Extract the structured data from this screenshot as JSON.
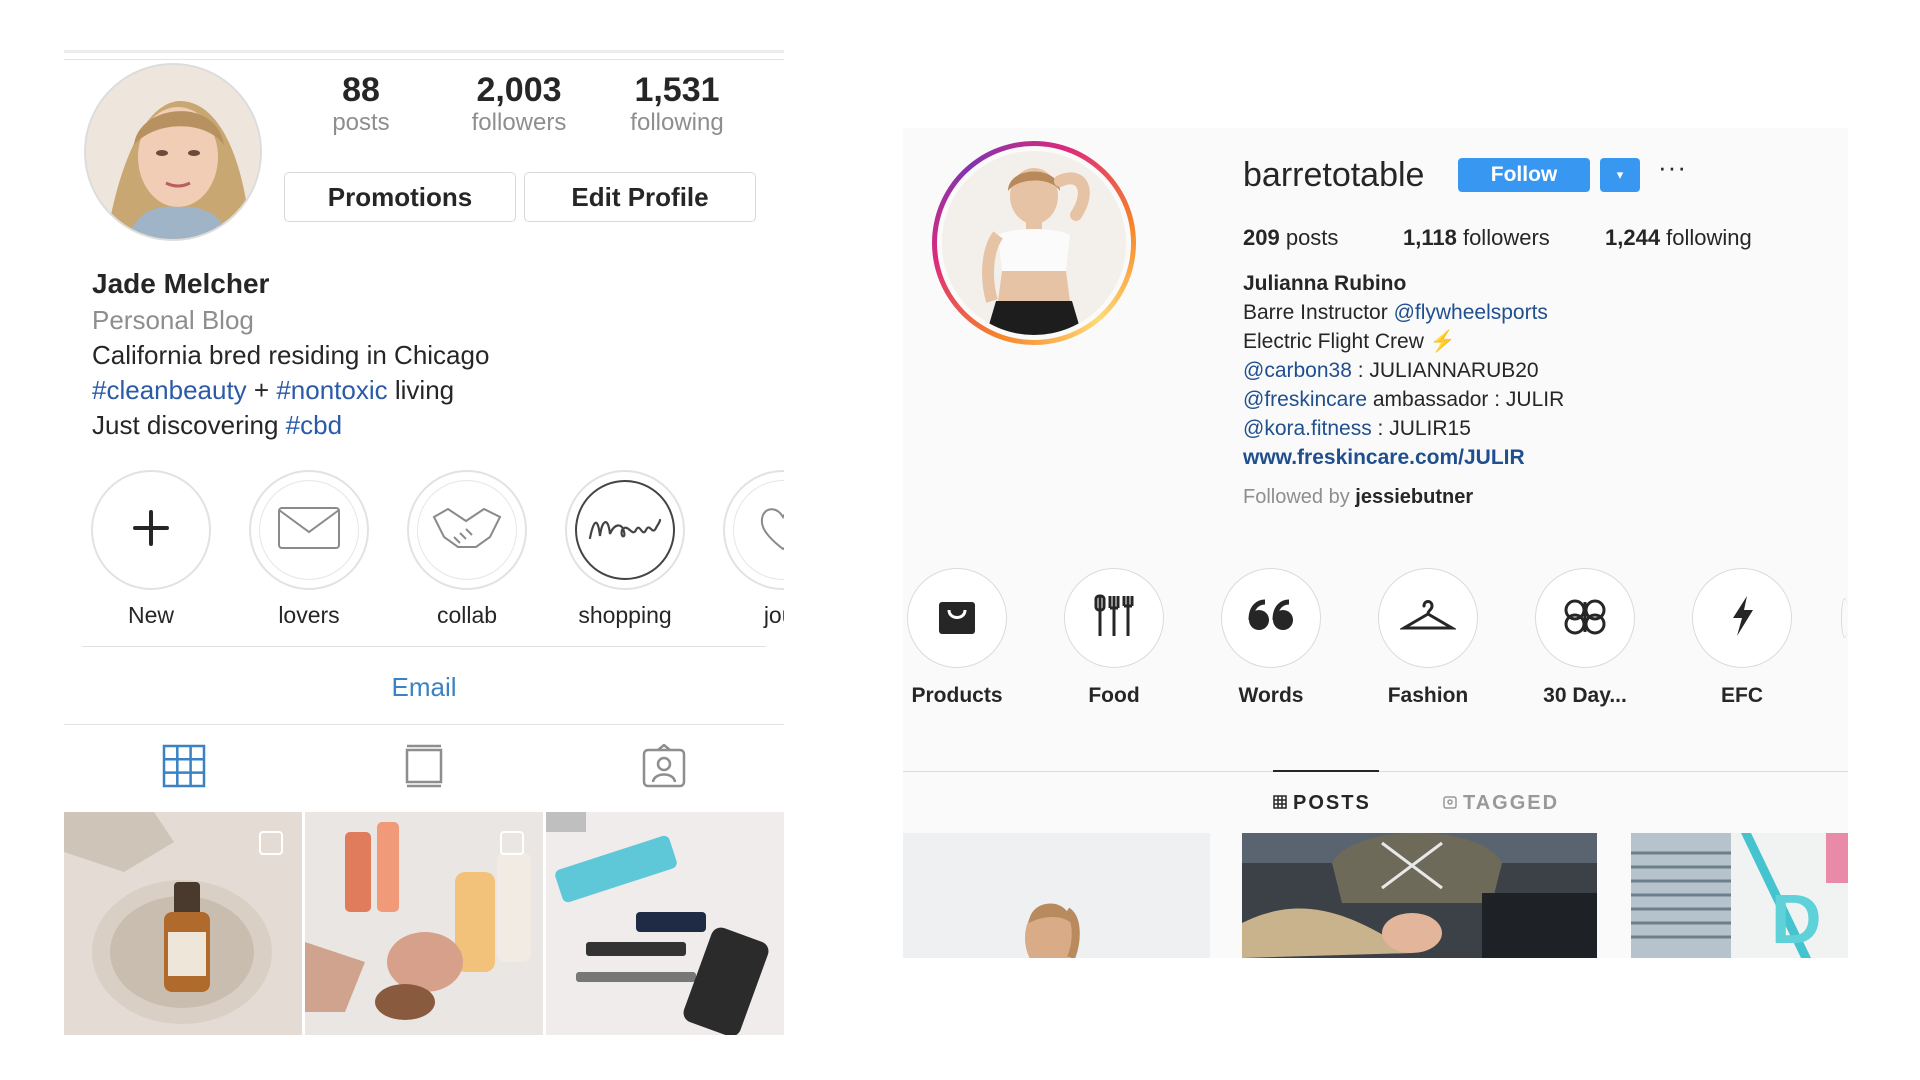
{
  "left_profile": {
    "stats": [
      {
        "value": "88",
        "label": "posts"
      },
      {
        "value": "2,003",
        "label": "followers"
      },
      {
        "value": "1,531",
        "label": "following"
      }
    ],
    "buttons": {
      "promotions": "Promotions",
      "edit_profile": "Edit Profile"
    },
    "name": "Jade Melcher",
    "category": "Personal Blog",
    "bio": {
      "line1": "California bred residing in Chicago",
      "line2_tag1": "#cleanbeauty",
      "line2_plus": " + ",
      "line2_tag2": "#nontoxic",
      "line2_rest": " living",
      "line3_text": "Just discovering ",
      "line3_tag": "#cbd"
    },
    "highlights": [
      {
        "label": "New",
        "icon": "plus-icon"
      },
      {
        "label": "lovers",
        "icon": "envelope-icon"
      },
      {
        "label": "collab",
        "icon": "handshake-icon"
      },
      {
        "label": "shopping",
        "icon": "new-script-icon"
      },
      {
        "label": "jour",
        "icon": "heart-icon"
      }
    ],
    "email_label": "Email",
    "tabs": [
      "grid-icon",
      "feed-icon",
      "tagged-icon"
    ],
    "colors": {
      "link": "#2a5aa8",
      "email": "#3a82c4",
      "active_tab": "#3a82c4"
    }
  },
  "right_profile": {
    "username": "barretotable",
    "follow_label": "Follow",
    "dropdown_glyph": "▾",
    "more_glyph": "···",
    "stats": {
      "posts_num": "209",
      "posts_lbl": " posts",
      "followers_num": "1,118",
      "followers_lbl": " followers",
      "following_num": "1,244",
      "following_lbl": " following"
    },
    "name": "Julianna Rubino",
    "bio": {
      "line1_text": "Barre Instructor ",
      "line1_link": "@flywheelsports",
      "line2_text": "Electric Flight Crew ",
      "line2_emoji": "⚡",
      "line3_link": "@carbon38",
      "line3_text": " : JULIANNARUB20",
      "line4_link": "@freskincare",
      "line4_text": " ambassador : JULIR",
      "line5_link": "@kora.fitness",
      "line5_text": " : JULIR15",
      "website": "www.freskincare.com/JULIR",
      "followed_by_text": "Followed by ",
      "followed_by_user": "jessiebutner"
    },
    "highlights": [
      {
        "label": "Products",
        "icon": "shopping-bag-icon"
      },
      {
        "label": "Food",
        "icon": "utensils-icon"
      },
      {
        "label": "Words",
        "icon": "quote-icon"
      },
      {
        "label": "Fashion",
        "icon": "hanger-icon"
      },
      {
        "label": "30 Day...",
        "icon": "ribbon-icon"
      },
      {
        "label": "EFC",
        "icon": "lightning-icon"
      }
    ],
    "tabs": {
      "posts": "POSTS",
      "tagged": "TAGGED"
    },
    "colors": {
      "follow_button": "#3897f0",
      "link": "#1f4f8f",
      "emoji": "#f5b642"
    }
  }
}
